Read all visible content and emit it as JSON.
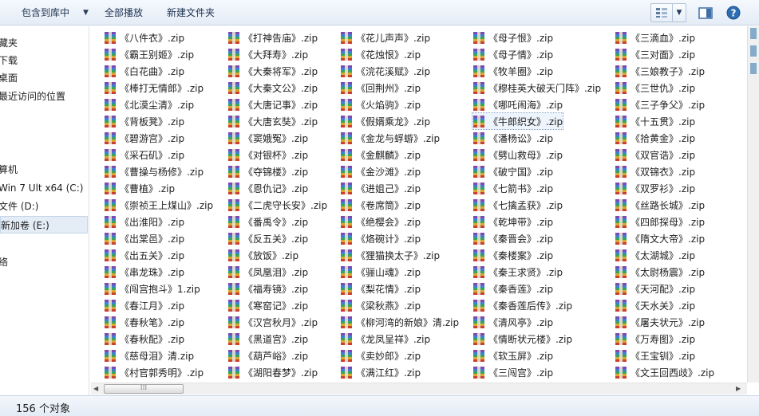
{
  "toolbar": {
    "include_library": "包含到库中",
    "play_all": "全部播放",
    "new_folder": "新建文件夹"
  },
  "nav": {
    "items": [
      "藏夹",
      "下载",
      "桌面",
      "最近访问的位置",
      "算机",
      "Win 7 Ult x64 (C:)",
      "文件 (D:)",
      "新加卷 (E:)",
      "络"
    ],
    "selected_index": 7
  },
  "status": {
    "count_text": "156 个对象"
  },
  "files": {
    "columns": [
      [
        "《八件衣》.zip",
        "《霸王别姬》.zip",
        "《白花曲》.zip",
        "《棒打无情郎》.zip",
        "《北漠尘清》.zip",
        "《背板凳》.zip",
        "《碧游宫》.zip",
        "《采石矶》.zip",
        "《曹操与杨修》.zip",
        "《曹植》.zip",
        "《崇祯王上煤山》.zip",
        "《出淮阳》.zip",
        "《出棠邑》.zip",
        "《出五关》.zip",
        "《串龙珠》.zip",
        "《闯宫抱斗》1.zip",
        "《春江月》.zip",
        "《春秋笔》.zip",
        "《春秋配》.zip",
        "《慈母泪》清.zip",
        "《村官郭秀明》.zip"
      ],
      [
        "《打神告庙》.zip",
        "《大拜寿》.zip",
        "《大秦将军》.zip",
        "《大秦文公》.zip",
        "《大唐记事》.zip",
        "《大唐玄奘》.zip",
        "《窦娥冤》.zip",
        "《对银杯》.zip",
        "《夺锦楼》.zip",
        "《恩仇记》.zip",
        "《二虎守长安》.zip",
        "《番禹令》.zip",
        "《反五关》.zip",
        "《放饭》.zip",
        "《凤凰泪》.zip",
        "《福寿镜》.zip",
        "《寒窑记》.zip",
        "《汉宫秋月》.zip",
        "《黑道宫》.zip",
        "《葫芦峪》.zip",
        "《湖阳春梦》.zip"
      ],
      [
        "《花儿声声》.zip",
        "《花烛恨》.zip",
        "《浣花溪赋》.zip",
        "《回荆州》.zip",
        "《火焰驹》.zip",
        "《假婿乘龙》.zip",
        "《金龙与蜉蝣》.zip",
        "《金麒麟》.zip",
        "《金沙滩》.zip",
        "《进姐己》.zip",
        "《卷席筒》.zip",
        "《绝樱会》.zip",
        "《烙碗计》.zip",
        "《狸猫换太子》.zip",
        "《骊山魂》.zip",
        "《梨花情》.zip",
        "《梁秋燕》.zip",
        "《柳河湾的新娘》清.zip",
        "《龙凤呈祥》.zip",
        "《卖妙郎》.zip",
        "《满江红》.zip"
      ],
      [
        "《母子恨》.zip",
        "《母子情》.zip",
        "《牧羊圈》.zip",
        "《穆桂英大破天门阵》.zip",
        "《哪吒闹海》.zip",
        "《牛郎织女》.zip",
        "《潘杨讼》.zip",
        "《劈山救母》.zip",
        "《破宁国》.zip",
        "《七箭书》.zip",
        "《七擒孟获》.zip",
        "《乾坤带》.zip",
        "《秦晋会》.zip",
        "《秦楼案》.zip",
        "《秦王求贤》.zip",
        "《秦香莲》.zip",
        "《秦香莲后传》.zip",
        "《清风亭》.zip",
        "《情断状元楼》.zip",
        "《软玉屏》.zip",
        "《三闯宫》.zip"
      ],
      [
        "《三滴血》.zip",
        "《三对面》.zip",
        "《三娘教子》.zip",
        "《三世仇》.zip",
        "《三子争父》.zip",
        "《十五贯》.zip",
        "《拾黄金》.zip",
        "《双官诰》.zip",
        "《双锦衣》.zip",
        "《双罗衫》.zip",
        "《丝路长城》.zip",
        "《四郎探母》.zip",
        "《隋文大帝》.zip",
        "《太湖城》.zip",
        "《太尉杨震》.zip",
        "《天河配》.zip",
        "《天水关》.zip",
        "《屠夫状元》.zip",
        "《万寿图》.zip",
        "《王宝钏》.zip",
        "《文王回西歧》.zip"
      ]
    ],
    "selected": [
      3,
      5
    ]
  },
  "colors": {
    "accent": "#3c7fb1",
    "selection": "#eef4fb"
  }
}
